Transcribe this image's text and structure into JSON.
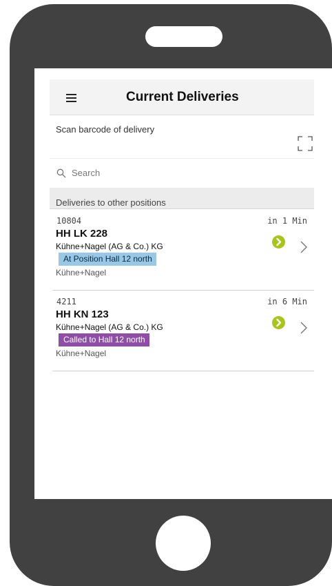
{
  "header": {
    "title": "Current Deliveries"
  },
  "scan": {
    "label": "Scan barcode of delivery"
  },
  "search": {
    "placeholder": "Search"
  },
  "section": {
    "label": "Deliveries to other positions"
  },
  "deliveries": [
    {
      "id": "10804",
      "eta": "in 1 Min",
      "plate": "HH LK 228",
      "company": "Kühne+Nagel (AG & Co.) KG",
      "status": "At Position Hall 12 north",
      "status_color": "#99c8e7",
      "carrier": "Kühne+Nagel"
    },
    {
      "id": "4211",
      "eta": "in 6 Min",
      "plate": "HH KN 123",
      "company": "Kühne+Nagel (AG & Co.) KG",
      "status": "Called to Hall 12 north",
      "status_color": "#8e4ea8",
      "carrier": "Kühne+Nagel"
    }
  ],
  "icons": {
    "menu": "hamburger-menu-icon",
    "scan": "barcode-scan-icon",
    "search": "search-icon",
    "go": "arrow-circle-icon",
    "chevron": "chevron-right-icon"
  },
  "colors": {
    "phone_body": "#414141",
    "accent_green": "#a7c51a",
    "status_blue": "#99c8e7",
    "status_purple": "#8e4ea8"
  }
}
